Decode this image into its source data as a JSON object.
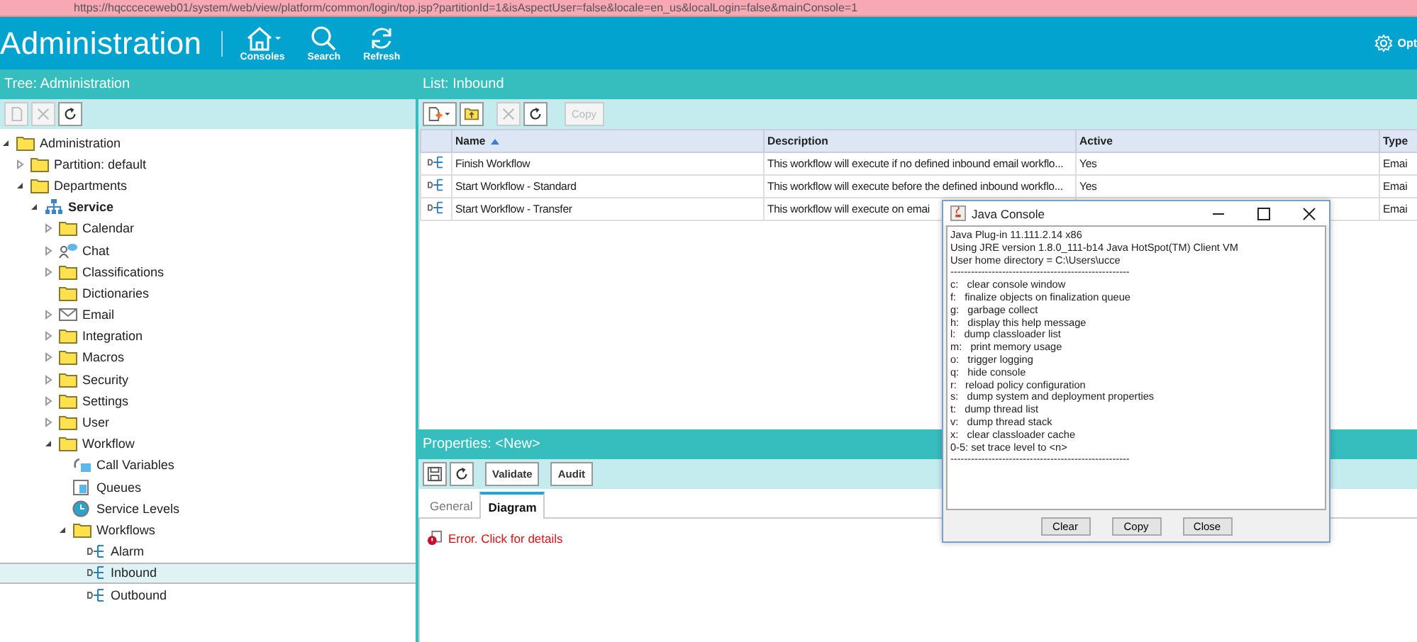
{
  "address_bar": {
    "url": "https://hqccceceweb01/system/web/view/platform/common/login/top.jsp?partitionId=1&isAspectUser=false&locale=en_us&localLogin=false&mainConsole=1"
  },
  "header": {
    "title": "Administration",
    "nav": [
      {
        "kind": "home",
        "label": "Consoles"
      },
      {
        "kind": "search",
        "label": "Search"
      },
      {
        "kind": "refresh",
        "label": "Refresh"
      }
    ],
    "options": {
      "label": "Opt"
    }
  },
  "tree_panel": {
    "title": "Tree: Administration",
    "toolbar": [
      {
        "kind": "document",
        "disabled": true
      },
      {
        "kind": "delete",
        "disabled": true
      },
      {
        "kind": "refresh",
        "disabled": false
      }
    ],
    "items": [
      {
        "label": "Administration",
        "kind": "folder",
        "selected": false,
        "expanded": true,
        "children": [
          {
            "label": "Partition: default",
            "kind": "folder",
            "selected": false,
            "expanded": false
          },
          {
            "label": "Departments",
            "kind": "folder",
            "selected": false,
            "expanded": true,
            "children": [
              {
                "label": "Service",
                "kind": "org",
                "bold": true,
                "selected": false,
                "expanded": true,
                "children": [
                  {
                    "label": "Calendar",
                    "kind": "folder",
                    "selected": false,
                    "expanded": false
                  },
                  {
                    "label": "Chat",
                    "kind": "chat",
                    "selected": false,
                    "expanded": false
                  },
                  {
                    "label": "Classifications",
                    "kind": "folder",
                    "selected": false,
                    "expanded": false
                  },
                  {
                    "label": "Dictionaries",
                    "kind": "folder",
                    "selected": false
                  },
                  {
                    "label": "Email",
                    "kind": "mail",
                    "selected": false,
                    "expanded": false
                  },
                  {
                    "label": "Integration",
                    "kind": "folder",
                    "selected": false,
                    "expanded": false
                  },
                  {
                    "label": "Macros",
                    "kind": "folder",
                    "selected": false,
                    "expanded": false
                  },
                  {
                    "label": "Security",
                    "kind": "folder",
                    "selected": false,
                    "expanded": false
                  },
                  {
                    "label": "Settings",
                    "kind": "folder",
                    "selected": false,
                    "expanded": false
                  },
                  {
                    "label": "User",
                    "kind": "folder",
                    "selected": false,
                    "expanded": false
                  },
                  {
                    "label": "Workflow",
                    "kind": "folder",
                    "selected": false,
                    "expanded": true,
                    "children": [
                      {
                        "label": "Call Variables",
                        "kind": "variables",
                        "selected": false
                      },
                      {
                        "label": "Queues",
                        "kind": "queue",
                        "selected": false
                      },
                      {
                        "label": "Service Levels",
                        "kind": "clock",
                        "selected": false
                      },
                      {
                        "label": "Workflows",
                        "kind": "folder",
                        "selected": false,
                        "expanded": true,
                        "children": [
                          {
                            "label": "Alarm",
                            "kind": "workflow",
                            "selected": false
                          },
                          {
                            "label": "Inbound",
                            "kind": "workflow",
                            "selected": true
                          },
                          {
                            "label": "Outbound",
                            "kind": "workflow",
                            "selected": false
                          }
                        ]
                      }
                    ]
                  }
                ]
              }
            ]
          }
        ]
      }
    ]
  },
  "list_panel": {
    "title": "List: Inbound",
    "toolbar": [
      {
        "kind": "new",
        "disabled": false
      },
      {
        "kind": "folder",
        "disabled": false
      },
      {
        "kind": "delete",
        "disabled": true
      },
      {
        "kind": "refresh",
        "disabled": false
      },
      {
        "kind": "text",
        "label": "Copy",
        "disabled": true
      }
    ],
    "table": {
      "columns": [
        {
          "label": "Name",
          "sorted": true
        },
        {
          "label": "Description",
          "sorted": false
        },
        {
          "label": "Active",
          "sorted": false
        },
        {
          "label": "Type",
          "sorted": false
        }
      ],
      "rows": [
        {
          "name": "Finish Workflow",
          "description": "This workflow will execute if no defined inbound email workflo...",
          "active": "Yes",
          "type": "Emai"
        },
        {
          "name": "Start Workflow - Standard",
          "description": "This workflow will execute before the defined inbound workflo...",
          "active": "Yes",
          "type": "Emai"
        },
        {
          "name": "Start Workflow - Transfer",
          "description": "This workflow will execute on emai",
          "type": "Emai"
        }
      ]
    }
  },
  "properties_panel": {
    "title": "Properties: <New>",
    "toolbar": [
      {
        "kind": "save",
        "disabled": false
      },
      {
        "kind": "refresh",
        "disabled": false
      },
      {
        "kind": "text",
        "label": "Validate",
        "disabled": false
      },
      {
        "kind": "text",
        "label": "Audit",
        "disabled": false
      }
    ],
    "tabs": [
      {
        "label": "General",
        "selected": false
      },
      {
        "label": "Diagram",
        "selected": true
      }
    ],
    "error": "Error. Click for details"
  },
  "java_console": {
    "title": "Java Console",
    "lines": [
      "Java Plug-in 11.111.2.14 x86",
      "Using JRE version 1.8.0_111-b14 Java HotSpot(TM) Client VM",
      "User home directory = C:\\Users\\ucce",
      "----------------------------------------------------",
      "c:   clear console window",
      "f:   finalize objects on finalization queue",
      "g:   garbage collect",
      "h:   display this help message",
      "l:   dump classloader list",
      "m:   print memory usage",
      "o:   trigger logging",
      "q:   hide console",
      "r:   reload policy configuration",
      "s:   dump system and deployment properties",
      "t:   dump thread list",
      "v:   dump thread stack",
      "x:   clear classloader cache",
      "0-5: set trace level to <n>",
      "----------------------------------------------------"
    ],
    "buttons": [
      "Clear",
      "Copy",
      "Close"
    ]
  }
}
